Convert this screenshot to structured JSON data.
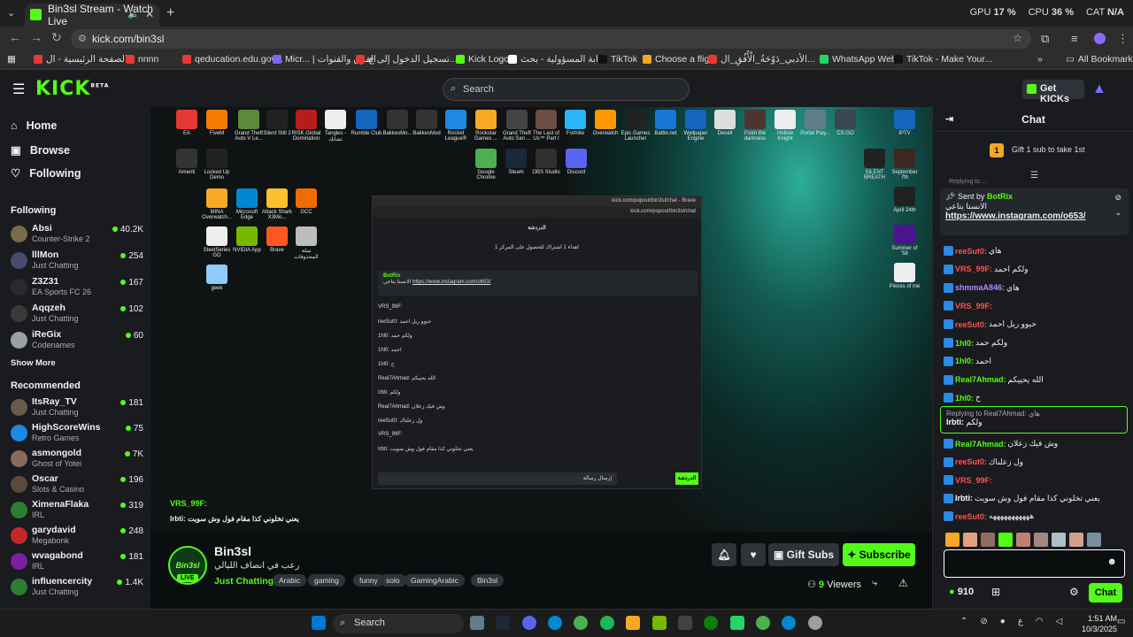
{
  "browser": {
    "tab_title": "Bin3sl Stream - Watch Live",
    "new_tab": "+",
    "url": "kick.com/bin3sl",
    "stats": {
      "gpu_label": "GPU",
      "gpu_value": "17 %",
      "cpu_label": "CPU",
      "cpu_value": "36 %",
      "cat_label": "CAT",
      "cat_value": "N/A"
    },
    "bookmarks": [
      {
        "label": "الصفحة الرئيسية - ال...",
        "color": "#e53935"
      },
      {
        "label": "nnnn",
        "color": "#e53935"
      },
      {
        "label": "qeducation.edu.gov...",
        "color": "#e53935"
      },
      {
        "label": "Micr... | الفرق والقنوات",
        "color": "#7b68ee"
      },
      {
        "label": "تسجيل الدخول إلى ج...",
        "color": "#e53935"
      },
      {
        "label": "Kick Logo",
        "color": "#53fc18"
      },
      {
        "label": "ابة المسؤولية - بحث...",
        "color": "#ffffff"
      },
      {
        "label": "TikTok",
        "color": "#111111"
      },
      {
        "label": "Choose a flight",
        "color": "#f5a623"
      },
      {
        "label": "الأدبي_دَوْحَةُ_الْأُفُقِ_ال...",
        "color": "#e53935"
      },
      {
        "label": "WhatsApp Web",
        "color": "#25d366"
      },
      {
        "label": "TikTok - Make Your...",
        "color": "#111111"
      }
    ],
    "all_bookmarks": "All Bookmarks"
  },
  "header": {
    "logo": "KICK",
    "logo_sup": "BETA",
    "search_placeholder": "Search",
    "get_kicks": "Get KICKs"
  },
  "sidebar": {
    "nav": [
      {
        "label": "Home",
        "icon": "home-icon",
        "glyph": "⌂"
      },
      {
        "label": "Browse",
        "icon": "browse-icon",
        "glyph": "▣"
      },
      {
        "label": "Following",
        "icon": "heart-icon",
        "glyph": "♡"
      }
    ],
    "following_title": "Following",
    "following": [
      {
        "name": "Absi",
        "game": "Counter-Strike 2",
        "viewers": "40.2K",
        "color": "#7a6a4a"
      },
      {
        "name": "lllMon",
        "game": "Just Chatting",
        "viewers": "254",
        "color": "#4a4a6a"
      },
      {
        "name": "Z3Z31",
        "game": "EA Sports FC 26",
        "viewers": "167",
        "color": "#2a2a2a"
      },
      {
        "name": "Aqqzeh",
        "game": "Just Chatting",
        "viewers": "102",
        "color": "#3a3a3a"
      },
      {
        "name": "iReGix",
        "game": "Codenames",
        "viewers": "60",
        "color": "#9aa0a6"
      }
    ],
    "show_more": "Show More",
    "recommended_title": "Recommended",
    "recommended": [
      {
        "name": "ItsRay_TV",
        "game": "Just Chatting",
        "viewers": "181",
        "color": "#6a5a4a"
      },
      {
        "name": "HighScoreWins",
        "game": "Retro Games",
        "viewers": "75",
        "color": "#1e88e5"
      },
      {
        "name": "asmongold",
        "game": "Ghost of Yotei",
        "viewers": "7K",
        "color": "#8a6a5a"
      },
      {
        "name": "Oscar",
        "game": "Slots & Casino",
        "viewers": "196",
        "color": "#5a4a3a"
      },
      {
        "name": "XimenaFlaka",
        "game": "IRL",
        "viewers": "319",
        "color": "#2e7d32"
      },
      {
        "name": "garydavid",
        "game": "Megabonk",
        "viewers": "248",
        "color": "#c62828"
      },
      {
        "name": "wvagabond",
        "game": "IRL",
        "viewers": "181",
        "color": "#7b1fa2"
      },
      {
        "name": "influencercity",
        "game": "Just Chatting",
        "viewers": "1.4K",
        "color": "#2e7d32"
      }
    ]
  },
  "video": {
    "desktop_icons": [
      {
        "label": "EA",
        "color": "#e53935"
      },
      {
        "label": "FiveM",
        "color": "#f57c00"
      },
      {
        "label": "Grand Theft Auto V Le...",
        "color": "#5d8a3a"
      },
      {
        "label": "Silent Still 2",
        "color": "#222222"
      },
      {
        "label": "RISK Global Domination",
        "color": "#b71c1c"
      },
      {
        "label": "Tangles - تشابك",
        "color": "#eeeeee"
      },
      {
        "label": "Rumble Club",
        "color": "#1565c0"
      },
      {
        "label": "BakkesMo...",
        "color": "#333333"
      },
      {
        "label": "BakkesMod",
        "color": "#333333"
      },
      {
        "label": "Rocket League®",
        "color": "#1e88e5"
      },
      {
        "label": "Rockstar Games ...",
        "color": "#f9a825"
      },
      {
        "label": "Grand Theft Auto San ...",
        "color": "#444444"
      },
      {
        "label": "The Last of Us™ Part I",
        "color": "#6d4c41"
      },
      {
        "label": "Fortnite",
        "color": "#29b6f6"
      },
      {
        "label": "Overwatch",
        "color": "#ff9800"
      },
      {
        "label": "Epic Games Launcher",
        "color": "#222222"
      },
      {
        "label": "Battle.net",
        "color": "#1976d2"
      },
      {
        "label": "Wallpaper Engine",
        "color": "#1565c0"
      },
      {
        "label": "Decell",
        "color": "#dddddd"
      },
      {
        "label": "From the darkness",
        "color": "#4e342e"
      },
      {
        "label": "Hollow Knight",
        "color": "#eeeeee"
      },
      {
        "label": "Portal Play...",
        "color": "#607d8b"
      },
      {
        "label": "CS:GO",
        "color": "#37474f"
      },
      {
        "label": "IPTV",
        "color": "#1565c0"
      }
    ],
    "desktop_icons_col": [
      {
        "label": "Amenti",
        "color": "#333333"
      },
      {
        "label": "Locked Up Demo",
        "color": "#222222"
      },
      {
        "label": "MINA Overwatch...",
        "color": "#f9a825"
      },
      {
        "label": "Microsoft Edge",
        "color": "#0288d1"
      },
      {
        "label": "Attack Shark X3Mo...",
        "color": "#fbc02d"
      },
      {
        "label": "GCC",
        "color": "#ef6c00"
      },
      {
        "label": "SteelSeries GG",
        "color": "#eeeeee"
      },
      {
        "label": "NVIDIA App",
        "color": "#76b900"
      },
      {
        "label": "Brave",
        "color": "#ff5722"
      },
      {
        "label": "سلة المحذوفات",
        "color": "#bdbdbd"
      },
      {
        "label": "geek",
        "color": "#90caf9"
      }
    ],
    "desktop_icons_mid": [
      {
        "label": "Google Chrome",
        "color": "#4caf50"
      },
      {
        "label": "Steam",
        "color": "#1b2838"
      },
      {
        "label": "OBS Studio",
        "color": "#302e31"
      },
      {
        "label": "Discord",
        "color": "#5865f2"
      }
    ],
    "desktop_icons_right": [
      {
        "label": "SILENT BREATH",
        "color": "#222222"
      },
      {
        "label": "September 7th",
        "color": "#3e2723"
      },
      {
        "label": "April 24th",
        "color": "#212121"
      },
      {
        "label": "Summer of '58",
        "color": "#4a148c"
      },
      {
        "label": "Pieces of me",
        "color": "#eeeeee"
      }
    ],
    "popup": {
      "url": "kick.com/popout/bin3sl/chat - Brave",
      "url2": "kick.com/popout/bin3sl/chat",
      "title": "الدردشة",
      "gift_line": "اهداء 1 اشتراك للحصول على المركز 1",
      "pinned_bot": "BotRix",
      "pinned_text": "الانستا يتاعي",
      "pinned_link": "https://www.instagram.com/o653/",
      "lines": [
        "VRS_99F:",
        "reeSut0: حيوو ريل احمد",
        "1hl0: ولكم حمد",
        "1hl0: احمد",
        "1hl0: ح",
        "Real7Ahmad: الله يحييكم",
        "Irbti: ولكم",
        "Real7Ahmad: وش فيك زعلان",
        "reeSut0: ول زعلناك",
        "VRS_99F:",
        "Irbti: يعني تخلوني كذا مقام فول وش سويت"
      ],
      "chat_btn": "الدردشة",
      "input_placeholder": "إرسال رسالة"
    },
    "overlay_user": "VRS_99F:",
    "overlay_user2": "Irbti:",
    "overlay_msg": "يعني تخلوني كذا مقام فول وش سويت"
  },
  "channel": {
    "avatar_text": "Bin3sl",
    "live": "LIVE",
    "name": "Bin3sl",
    "title": "رعب في انصاف الليالي",
    "category": "Just Chatting",
    "tags": [
      "Arabic",
      "gaming",
      "funny",
      "solo",
      "GamingArabic",
      "Bin3sl"
    ],
    "gift_subs": "Gift Subs",
    "subscribe": "Subscribe",
    "viewers_count": "9",
    "viewers_label": "Viewers"
  },
  "chat": {
    "title": "Chat",
    "gift_count": "1",
    "gift_text": "Gift 1 sub to take 1st",
    "replying_top": "Replying to ...",
    "pinned_sent_by": "Sent by",
    "pinned_bot": "BotRix",
    "pinned_text": "الانستا يتاعي",
    "pinned_link": "https://www.instagram.com/o653/",
    "messages": [
      {
        "user": "reeSut0:",
        "text": "هاي",
        "color": "#ff5252"
      },
      {
        "user": "VRS_99F:",
        "text": "ولكم احمد",
        "color": "#ff5252"
      },
      {
        "user": "shmmaA846:",
        "text": "هاي",
        "color": "#b388ff"
      },
      {
        "user": "VRS_99F:",
        "text": "",
        "color": "#ff5252"
      },
      {
        "user": "reeSut0:",
        "text": "حيوو ريل احمد",
        "color": "#ff5252"
      },
      {
        "user": "1hl0:",
        "text": "ولكم حمد",
        "color": "#53fc18"
      },
      {
        "user": "1hl0:",
        "text": "احمد",
        "color": "#53fc18"
      },
      {
        "user": "Real7Ahmad:",
        "text": "الله يحييكم",
        "color": "#53fc18"
      },
      {
        "user": "1hl0:",
        "text": "ح",
        "color": "#53fc18"
      }
    ],
    "reply_to": "Replying to Real7Ahmad: هاي",
    "reply_user": "Irbti:",
    "reply_text": "ولكم",
    "messages2": [
      {
        "user": "Real7Ahmad:",
        "text": "وش فيك زعلان",
        "color": "#53fc18"
      },
      {
        "user": "reeSut0:",
        "text": "ول زعلناك",
        "color": "#ff5252"
      },
      {
        "user": "VRS_99F:",
        "text": "",
        "color": "#ff5252"
      },
      {
        "user": "Irbti:",
        "text": "يعني تخلوني كذا مقام فول وش سويت",
        "color": "#ffffff"
      },
      {
        "user": "reeSut0:",
        "text": "هههههههههههه",
        "color": "#ff5252"
      }
    ],
    "kicks_points": "910",
    "chat_button": "Chat"
  },
  "taskbar": {
    "search": "Search",
    "time": "1:51 AM",
    "date": "10/3/2025",
    "lang": "ع"
  }
}
